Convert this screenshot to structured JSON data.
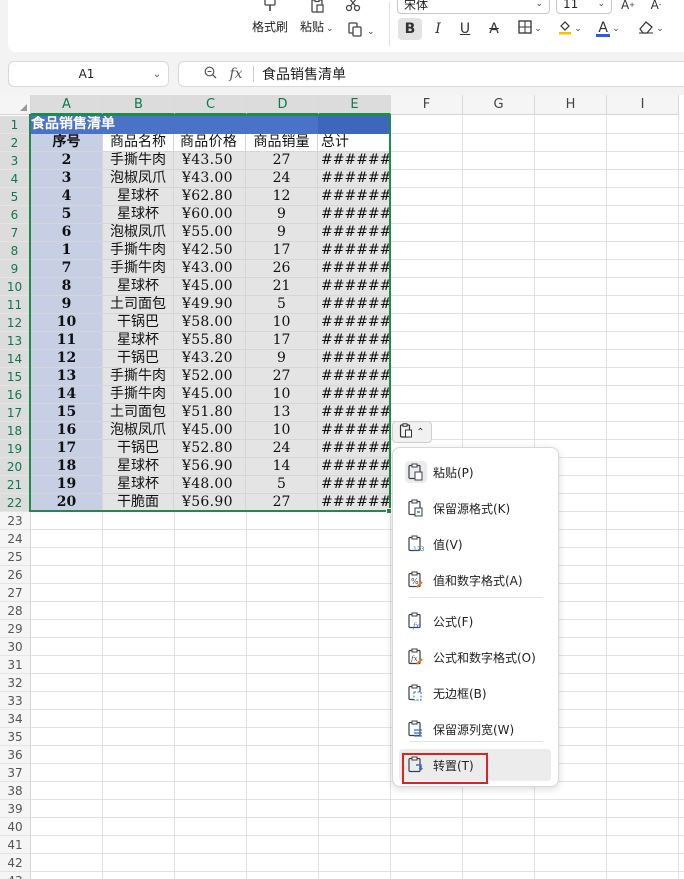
{
  "toolbar": {
    "format_painter_label": "格式刷",
    "paste_label": "粘贴",
    "font_name": "宋体",
    "font_size": "11",
    "icons": [
      "format-painter-icon",
      "paste-icon",
      "cut-icon",
      "copy-format-icon",
      "bold-icon",
      "italic-icon",
      "underline-icon",
      "strikethrough-icon",
      "border-icon",
      "fill-color-icon",
      "font-color-icon",
      "clear-icon",
      "increase-font-icon",
      "decrease-font-icon"
    ]
  },
  "formula_bar": {
    "name_box": "A1",
    "content": "食品销售清单"
  },
  "columns": [
    "A",
    "B",
    "C",
    "D",
    "E",
    "F",
    "G",
    "H",
    "I"
  ],
  "rows": [
    "1",
    "2",
    "3",
    "4",
    "5",
    "6",
    "7",
    "8",
    "9",
    "10",
    "11",
    "12",
    "13",
    "14",
    "15",
    "16",
    "17",
    "18",
    "19",
    "20",
    "21",
    "22",
    "23",
    "24",
    "25",
    "26",
    "27",
    "28",
    "29",
    "30",
    "31",
    "32",
    "33",
    "34",
    "35",
    "36",
    "37",
    "38",
    "39",
    "40",
    "41",
    "42",
    "43"
  ],
  "sheet": {
    "title": "食品销售清单",
    "headers": [
      "序号",
      "商品名称",
      "商品价格",
      "商品销量",
      "总计"
    ],
    "rows": [
      [
        "2",
        "手撕牛肉",
        "¥43.50",
        "27",
        "########"
      ],
      [
        "3",
        "泡椒凤爪",
        "¥43.00",
        "24",
        "########"
      ],
      [
        "4",
        "星球杯",
        "¥62.80",
        "12",
        "########"
      ],
      [
        "5",
        "星球杯",
        "¥60.00",
        "9",
        "########"
      ],
      [
        "6",
        "泡椒凤爪",
        "¥55.00",
        "9",
        "########"
      ],
      [
        "1",
        "手撕牛肉",
        "¥42.50",
        "17",
        "########"
      ],
      [
        "7",
        "手撕牛肉",
        "¥43.00",
        "26",
        "########"
      ],
      [
        "8",
        "星球杯",
        "¥45.00",
        "21",
        "########"
      ],
      [
        "9",
        "土司面包",
        "¥49.90",
        "5",
        "########"
      ],
      [
        "10",
        "干锅巴",
        "¥58.00",
        "10",
        "########"
      ],
      [
        "11",
        "星球杯",
        "¥55.80",
        "17",
        "########"
      ],
      [
        "12",
        "干锅巴",
        "¥43.20",
        "9",
        "########"
      ],
      [
        "13",
        "手撕牛肉",
        "¥52.00",
        "27",
        "########"
      ],
      [
        "14",
        "手撕牛肉",
        "¥45.00",
        "10",
        "########"
      ],
      [
        "15",
        "土司面包",
        "¥51.80",
        "13",
        "########"
      ],
      [
        "16",
        "泡椒凤爪",
        "¥45.00",
        "10",
        "########"
      ],
      [
        "17",
        "干锅巴",
        "¥52.80",
        "24",
        "########"
      ],
      [
        "18",
        "星球杯",
        "¥56.90",
        "14",
        "########"
      ],
      [
        "19",
        "星球杯",
        "¥48.00",
        "5",
        "########"
      ],
      [
        "20",
        "干脆面",
        "¥56.90",
        "27",
        "########"
      ]
    ]
  },
  "paste_menu": {
    "items": [
      {
        "label": "粘贴(P)",
        "icon": "paste-icon"
      },
      {
        "label": "保留源格式(K)",
        "icon": "keep-source-format-icon"
      },
      {
        "label": "值(V)",
        "icon": "paste-values-icon"
      },
      {
        "label": "值和数字格式(A)",
        "icon": "values-number-format-icon"
      },
      {
        "label": "公式(F)",
        "icon": "paste-formula-icon"
      },
      {
        "label": "公式和数字格式(O)",
        "icon": "formula-number-format-icon"
      },
      {
        "label": "无边框(B)",
        "icon": "no-border-icon"
      },
      {
        "label": "保留源列宽(W)",
        "icon": "keep-column-width-icon"
      },
      {
        "label": "转置(T)",
        "icon": "transpose-icon"
      }
    ]
  },
  "colors": {
    "title_fill": "#4a72c9",
    "index_col_fill": "#c7cfe4",
    "data_fill": "#e4e4e4",
    "selection": "#1e8a4e",
    "highlight_box": "#dd2222"
  }
}
